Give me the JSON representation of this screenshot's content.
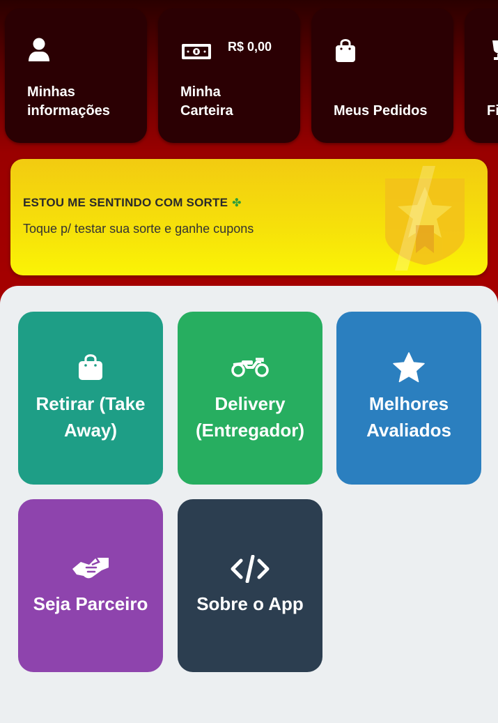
{
  "top_menu": {
    "items": [
      {
        "label": "Minhas\ninformações",
        "icon": "user-icon"
      },
      {
        "label": "Minha\nCarteira",
        "icon": "money-bill-icon",
        "balance": "R$ 0,00"
      },
      {
        "label": "Meus Pedidos",
        "icon": "shopping-bag-icon"
      },
      {
        "label": "Fi",
        "icon": "trophy-icon"
      }
    ]
  },
  "luck_banner": {
    "title": "ESTOU ME SENTINDO COM SORTE",
    "subtitle": "Toque p/ testar sua sorte e ganhe cupons",
    "icon": "star-badge-icon"
  },
  "grid": {
    "tiles": [
      {
        "label": "Retirar (Take\nAway)",
        "icon": "shopping-bag-icon",
        "color": "#1e9e86"
      },
      {
        "label": "Delivery\n(Entregador)",
        "icon": "motorcycle-icon",
        "color": "#27ae60"
      },
      {
        "label": "Melhores\nAvaliados",
        "icon": "star-icon",
        "color": "#2b7fbf"
      },
      {
        "label": "Seja  Parceiro",
        "icon": "handshake-icon",
        "color": "#8e44ad"
      },
      {
        "label": "Sobre o App",
        "icon": "code-icon",
        "color": "#2c3e50"
      }
    ]
  }
}
